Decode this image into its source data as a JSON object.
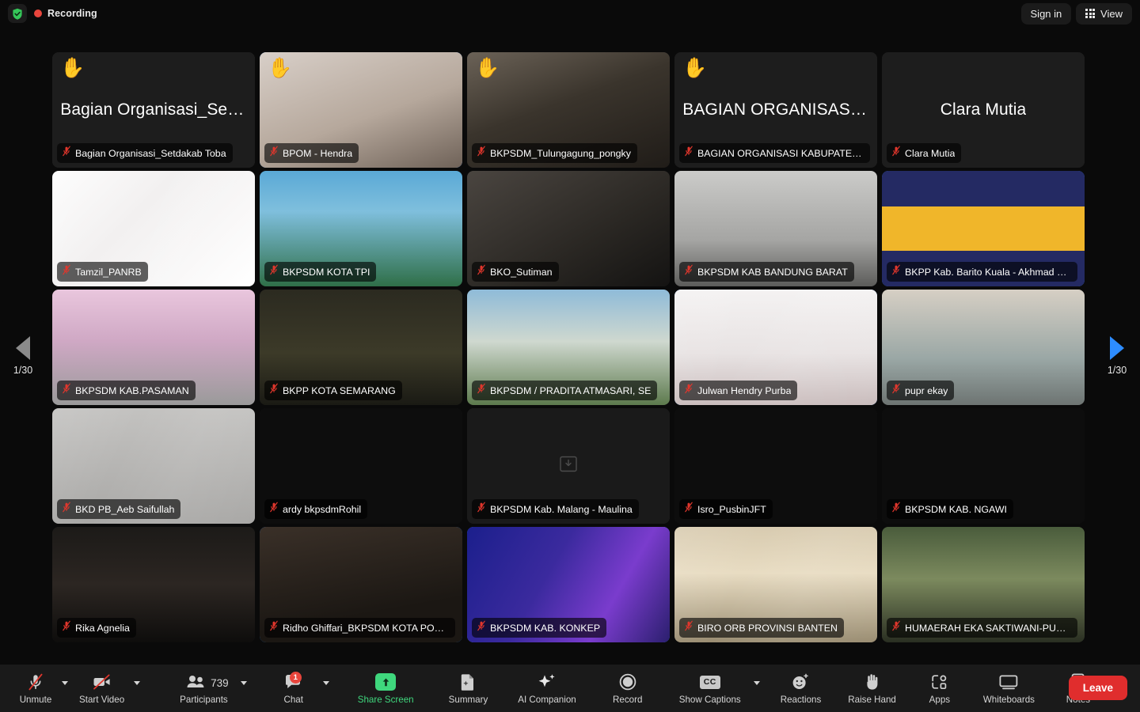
{
  "topbar": {
    "recording_label": "Recording",
    "shield_icon": "shield-check-icon",
    "sign_in_label": "Sign in",
    "view_label": "View",
    "view_icon": "grid-icon"
  },
  "pagination": {
    "prev_icon": "chevron-left-icon",
    "next_icon": "chevron-right-icon",
    "prev_page_indicator": "1/30",
    "next_page_indicator": "1/30"
  },
  "gallery": {
    "participants": [
      {
        "name": "Bagian Organisasi_Setdakab Toba",
        "display_name": "Bagian Organisasi_Setd...",
        "muted": true,
        "hand_raised": true,
        "video_on": false,
        "active_speaker": false,
        "bg": "bg-dark"
      },
      {
        "name": "BPOM - Hendra",
        "display_name": "",
        "muted": true,
        "hand_raised": true,
        "video_on": true,
        "active_speaker": true,
        "bg": "bg-office"
      },
      {
        "name": "BKPSDM_Tulungagung_pongky",
        "display_name": "",
        "muted": true,
        "hand_raised": true,
        "video_on": true,
        "active_speaker": false,
        "bg": "bg-person-a"
      },
      {
        "name": "BAGIAN ORGANISASI KABUPATEN AC...",
        "display_name": "BAGIAN ORGANISASI K...",
        "muted": true,
        "hand_raised": true,
        "video_on": false,
        "active_speaker": false,
        "bg": "bg-dark"
      },
      {
        "name": "Clara Mutia",
        "display_name": "Clara Mutia",
        "muted": true,
        "hand_raised": false,
        "video_on": false,
        "active_speaker": false,
        "bg": "bg-dark"
      },
      {
        "name": "Tamzil_PANRB",
        "display_name": "",
        "muted": true,
        "hand_raised": false,
        "video_on": true,
        "active_speaker": false,
        "bg": "bg-white-id"
      },
      {
        "name": "BKPSDM KOTA TPI",
        "display_name": "",
        "muted": true,
        "hand_raised": false,
        "video_on": true,
        "active_speaker": false,
        "bg": "bg-blue-sky"
      },
      {
        "name": "BKO_Sutiman",
        "display_name": "",
        "muted": true,
        "hand_raised": false,
        "video_on": true,
        "active_speaker": false,
        "bg": "bg-person-b"
      },
      {
        "name": "BKPSDM KAB BANDUNG BARAT",
        "display_name": "",
        "muted": true,
        "hand_raised": false,
        "video_on": true,
        "active_speaker": false,
        "bg": "bg-light-room"
      },
      {
        "name": "BKPP Kab. Barito Kuala - Akhmad Gaja...",
        "display_name": "",
        "muted": true,
        "hand_raised": false,
        "video_on": true,
        "active_speaker": true,
        "bg": "bg-navy"
      },
      {
        "name": "BKPSDM KAB.PASAMAN",
        "display_name": "",
        "muted": true,
        "hand_raised": false,
        "video_on": true,
        "active_speaker": false,
        "bg": "bg-pink-slide"
      },
      {
        "name": "BKPP KOTA SEMARANG",
        "display_name": "",
        "muted": true,
        "hand_raised": false,
        "video_on": true,
        "active_speaker": false,
        "bg": "bg-olive"
      },
      {
        "name": "BKPSDM / PRADITA ATMASARI, SE",
        "display_name": "",
        "muted": true,
        "hand_raised": false,
        "video_on": true,
        "active_speaker": false,
        "bg": "bg-building"
      },
      {
        "name": "Julwan Hendry Purba",
        "display_name": "",
        "muted": true,
        "hand_raised": false,
        "video_on": true,
        "active_speaker": true,
        "bg": "bg-brin"
      },
      {
        "name": "pupr ekay",
        "display_name": "",
        "muted": true,
        "hand_raised": false,
        "video_on": true,
        "active_speaker": false,
        "bg": "bg-street"
      },
      {
        "name": "BKD PB_Aeb Saifullah",
        "display_name": "",
        "muted": true,
        "hand_raised": false,
        "video_on": true,
        "active_speaker": false,
        "bg": "bg-grey-slide"
      },
      {
        "name": "ardy bkpsdmRohil",
        "display_name": "",
        "muted": true,
        "hand_raised": false,
        "video_on": true,
        "active_speaker": false,
        "bg": "bg-black"
      },
      {
        "name": "BKPSDM Kab. Malang - Maulina",
        "display_name": "",
        "muted": true,
        "hand_raised": false,
        "video_on": true,
        "active_speaker": false,
        "bg": "bg-noimg"
      },
      {
        "name": "Isro_PusbinJFT",
        "display_name": "",
        "muted": true,
        "hand_raised": false,
        "video_on": true,
        "active_speaker": false,
        "bg": "bg-black"
      },
      {
        "name": "BKPSDM KAB. NGAWI",
        "display_name": "",
        "muted": true,
        "hand_raised": false,
        "video_on": true,
        "active_speaker": false,
        "bg": "bg-black"
      },
      {
        "name": "Rika Agnelia",
        "display_name": "",
        "muted": true,
        "hand_raised": false,
        "video_on": true,
        "active_speaker": false,
        "bg": "bg-bokeh-dark"
      },
      {
        "name": "Ridho Ghiffari_BKPSDM KOTA PONTIA...",
        "display_name": "",
        "muted": true,
        "hand_raised": false,
        "video_on": true,
        "active_speaker": true,
        "bg": "bg-dark-person"
      },
      {
        "name": "BKPSDM KAB. KONKEP",
        "display_name": "",
        "muted": true,
        "hand_raised": false,
        "video_on": true,
        "active_speaker": true,
        "bg": "bg-gradient-blue"
      },
      {
        "name": "BIRO ORB PROVINSI BANTEN",
        "display_name": "",
        "muted": true,
        "hand_raised": false,
        "video_on": true,
        "active_speaker": false,
        "bg": "bg-banten"
      },
      {
        "name": "HUMAERAH EKA SAKTIWANI-PUPR K...",
        "display_name": "",
        "muted": true,
        "hand_raised": false,
        "video_on": true,
        "active_speaker": false,
        "bg": "bg-monument"
      }
    ]
  },
  "toolbar": {
    "unmute_label": "Unmute",
    "unmute_icon": "mic-muted-icon",
    "start_video_label": "Start Video",
    "start_video_icon": "video-off-icon",
    "participants_label": "Participants",
    "participants_icon": "people-icon",
    "participants_count": "739",
    "chat_label": "Chat",
    "chat_icon": "chat-bubble-icon",
    "chat_badge": "1",
    "share_screen_label": "Share Screen",
    "share_screen_icon": "share-screen-icon",
    "summary_label": "Summary",
    "summary_icon": "summary-doc-icon",
    "ai_companion_label": "AI Companion",
    "ai_companion_icon": "sparkle-icon",
    "record_label": "Record",
    "record_icon": "record-circle-icon",
    "show_captions_label": "Show Captions",
    "show_captions_icon": "cc-icon",
    "reactions_label": "Reactions",
    "reactions_icon": "smiley-plus-icon",
    "raise_hand_label": "Raise Hand",
    "raise_hand_icon": "raised-hand-icon",
    "apps_label": "Apps",
    "apps_icon": "apps-icon",
    "whiteboards_label": "Whiteboards",
    "whiteboards_icon": "whiteboard-icon",
    "notes_label": "Notes",
    "notes_icon": "notes-icon",
    "leave_label": "Leave"
  },
  "colors": {
    "accent_blue": "#2d8cff",
    "recording_red": "#e8453c",
    "share_green": "#3fd77d",
    "leave_red": "#e02d2d",
    "background": "#0a0a0a",
    "toolbar_background": "#1a1a1a"
  }
}
